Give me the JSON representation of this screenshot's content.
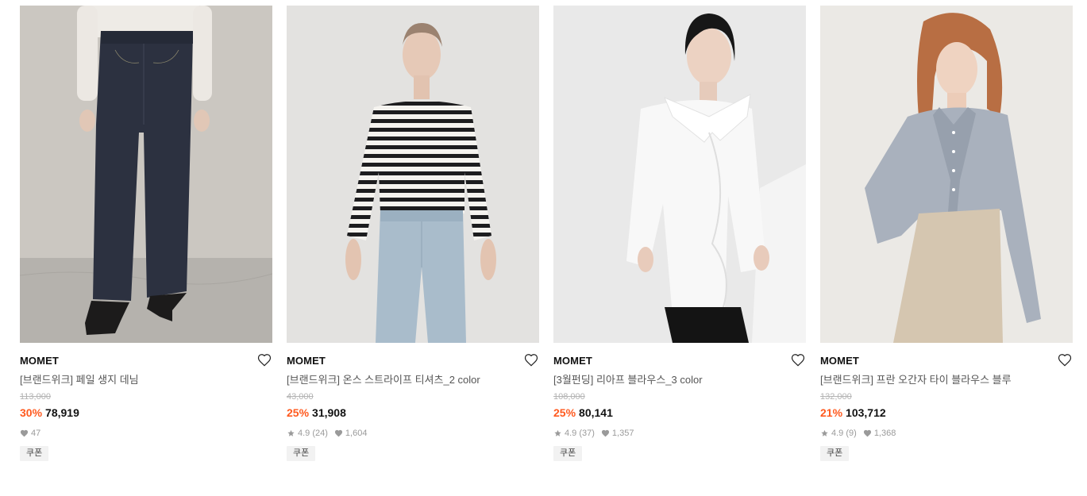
{
  "products": [
    {
      "brand": "MOMET",
      "name": "[브랜드위크] 페일 생지 데님",
      "original_price": "113,000",
      "discount": "30%",
      "price": "78,919",
      "rating": "",
      "reviews": "",
      "likes": "47",
      "coupon": "쿠폰",
      "image": "model-wearing-dark-wide-leg-denim"
    },
    {
      "brand": "MOMET",
      "name": "[브랜드위크] 온스 스트라이프 티셔츠_2 color",
      "original_price": "43,000",
      "discount": "25%",
      "price": "31,908",
      "rating": "4.9",
      "reviews": "(24)",
      "likes": "1,604",
      "coupon": "쿠폰",
      "image": "model-in-striped-boat-neck-tee"
    },
    {
      "brand": "MOMET",
      "name": "[3월펀딩] 리아프 블라우스_3 color",
      "original_price": "108,000",
      "discount": "25%",
      "price": "80,141",
      "rating": "4.9",
      "reviews": "(37)",
      "likes": "1,357",
      "coupon": "쿠폰",
      "image": "model-in-white-ruffle-blouse"
    },
    {
      "brand": "MOMET",
      "name": "[브랜드위크] 프란 오간자 타이 블라우스 블루",
      "original_price": "132,000",
      "discount": "21%",
      "price": "103,712",
      "rating": "4.9",
      "reviews": "(9)",
      "likes": "1,368",
      "coupon": "쿠폰",
      "image": "model-in-blue-organza-tie-blouse"
    }
  ],
  "colors": {
    "discount": "#ff5a1f",
    "meta_gray": "#9a9a9a",
    "coupon_bg": "#f2f2f2"
  },
  "icons": {
    "wishlist": "heart-outline-icon",
    "rating": "star-icon",
    "likes": "heart-filled-icon"
  }
}
